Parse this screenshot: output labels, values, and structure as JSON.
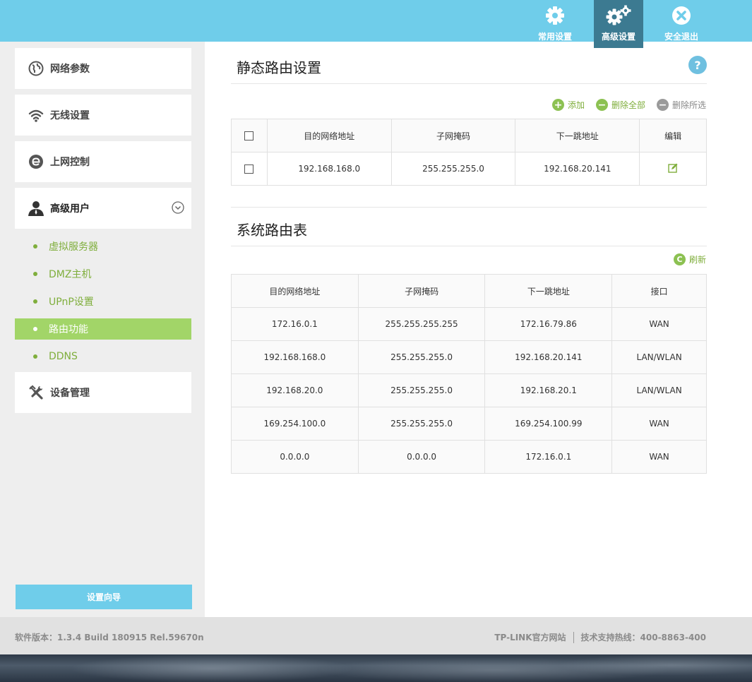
{
  "topnav": {
    "basic_label": "常用设置",
    "advanced_label": "高级设置",
    "exit_label": "安全退出"
  },
  "sidebar": {
    "menu": [
      {
        "label": "网络参数",
        "icon": "globe-icon"
      },
      {
        "label": "无线设置",
        "icon": "wifi-icon"
      },
      {
        "label": "上网控制",
        "icon": "internet-e-icon"
      },
      {
        "label": "高级用户",
        "icon": "user-icon"
      },
      {
        "label": "设备管理",
        "icon": "tools-icon"
      }
    ],
    "submenu": [
      {
        "label": "虚拟服务器"
      },
      {
        "label": "DMZ主机"
      },
      {
        "label": "UPnP设置"
      },
      {
        "label": "路由功能"
      },
      {
        "label": "DDNS"
      }
    ],
    "wizard_label": "设置向导"
  },
  "static_route": {
    "title": "静态路由设置",
    "help": "?",
    "actions": {
      "add": "添加",
      "delete_all": "删除全部",
      "delete_selected": "删除所选"
    },
    "headers": [
      "目的网络地址",
      "子网掩码",
      "下一跳地址",
      "编辑"
    ],
    "rows": [
      {
        "dest": "192.168.168.0",
        "mask": "255.255.255.0",
        "gateway": "192.168.20.141"
      }
    ]
  },
  "system_route": {
    "title": "系统路由表",
    "refresh": "刷新",
    "headers": [
      "目的网络地址",
      "子网掩码",
      "下一跳地址",
      "接口"
    ],
    "rows": [
      [
        "172.16.0.1",
        "255.255.255.255",
        "172.16.79.86",
        "WAN"
      ],
      [
        "192.168.168.0",
        "255.255.255.0",
        "192.168.20.141",
        "LAN/WLAN"
      ],
      [
        "192.168.20.0",
        "255.255.255.0",
        "192.168.20.1",
        "LAN/WLAN"
      ],
      [
        "169.254.100.0",
        "255.255.255.0",
        "169.254.100.99",
        "WAN"
      ],
      [
        "0.0.0.0",
        "0.0.0.0",
        "172.16.0.1",
        "WAN"
      ]
    ]
  },
  "footer": {
    "version": "软件版本：1.3.4 Build 180915 Rel.59670n",
    "site": "TP-LINK官方网站",
    "hotline": "技术支持热线：400-8863-400"
  },
  "colors": {
    "topbar": "#6fcdea",
    "active_nav": "#3c7a91",
    "green": "#7fae3c",
    "active_sub": "#a2d568"
  }
}
